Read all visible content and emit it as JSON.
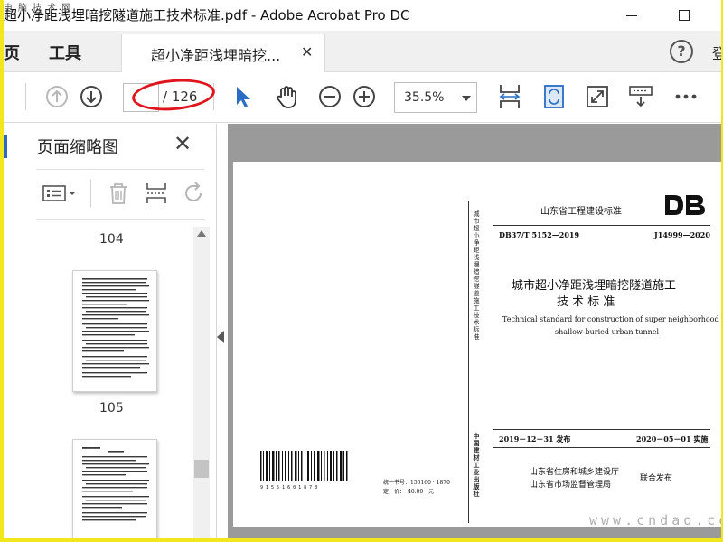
{
  "window": {
    "title": "超小净距浅埋暗挖隧道施工技术标准.pdf - Adobe Acrobat Pro DC",
    "watermark_corner": "电 脑 技 术 网"
  },
  "tabs": {
    "home": "页",
    "tools": "工具",
    "document": "超小净距浅埋暗挖...",
    "signin_fragment": "登"
  },
  "toolbar": {
    "page_current": "",
    "page_total": "/ 126",
    "zoom": "35.5%"
  },
  "left_panel": {
    "title": "页面缩略图",
    "thumbnails": [
      {
        "label": "104"
      },
      {
        "label": "105"
      }
    ]
  },
  "document_page": {
    "issuer_top": "山东省工程建设标准",
    "logo": "DB",
    "standard_code": "DB37/T 5152—2019",
    "record_code": "J14999—2020",
    "title_cn_line1": "城市超小净距浅埋暗挖隧道施工",
    "title_cn_line2": "技 术 标 准",
    "title_en_line1": "Technical standard for construction of super neighborhood",
    "title_en_line2": "shallow-buried urban tunnel",
    "spine_text": "城市超小净距浅埋暗挖隧道施工技术标准",
    "spine_publisher": "中国建材工业出版社",
    "publish_date": "2019－12－31 发布",
    "implement_date": "2020－05－01 实施",
    "issuer_1": "山东省住房和城乡建设厅",
    "issuer_2": "山东省市场监督管理局",
    "joint_release": "联合发布",
    "barcode_digits": "9 1 5 5 1 6 0 1 8 7 0",
    "book_number": "统一书号：155160 · 1870",
    "price": "定　价：　40.00　元"
  },
  "watermark": "www.cndao.com",
  "colors": {
    "accent_blue": "#2a6cc4",
    "annotation_red": "#e0141c",
    "frame_yellow": "#f2e71c"
  }
}
